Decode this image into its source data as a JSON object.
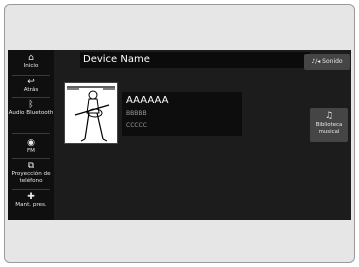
{
  "sidebar": {
    "items": [
      {
        "icon": "home-icon",
        "glyph": "⌂",
        "label": "Inicio"
      },
      {
        "icon": "back-icon",
        "glyph": "↩",
        "label": "Atrás"
      },
      {
        "icon": "bluetooth-icon",
        "glyph": "ᛒ",
        "label": "Audio Bluetooth"
      },
      {
        "icon": "radio-icon",
        "glyph": "◉",
        "label": "FM"
      },
      {
        "icon": "phone-projection-icon",
        "glyph": "⧉",
        "label": "Proyección de teléfono"
      },
      {
        "icon": "add-icon",
        "glyph": "✚",
        "label": "Mant. pres."
      }
    ]
  },
  "header": {
    "device_name": "Device Name",
    "source_button_icon": "♪/◂",
    "source_button_label": "Sonido"
  },
  "track": {
    "title": "AAAAAA",
    "artist": "BBBBB",
    "album": "CCCCC"
  },
  "library_button": {
    "icon": "music-library-icon",
    "glyph": "♫",
    "label": "Biblioteca musical"
  }
}
